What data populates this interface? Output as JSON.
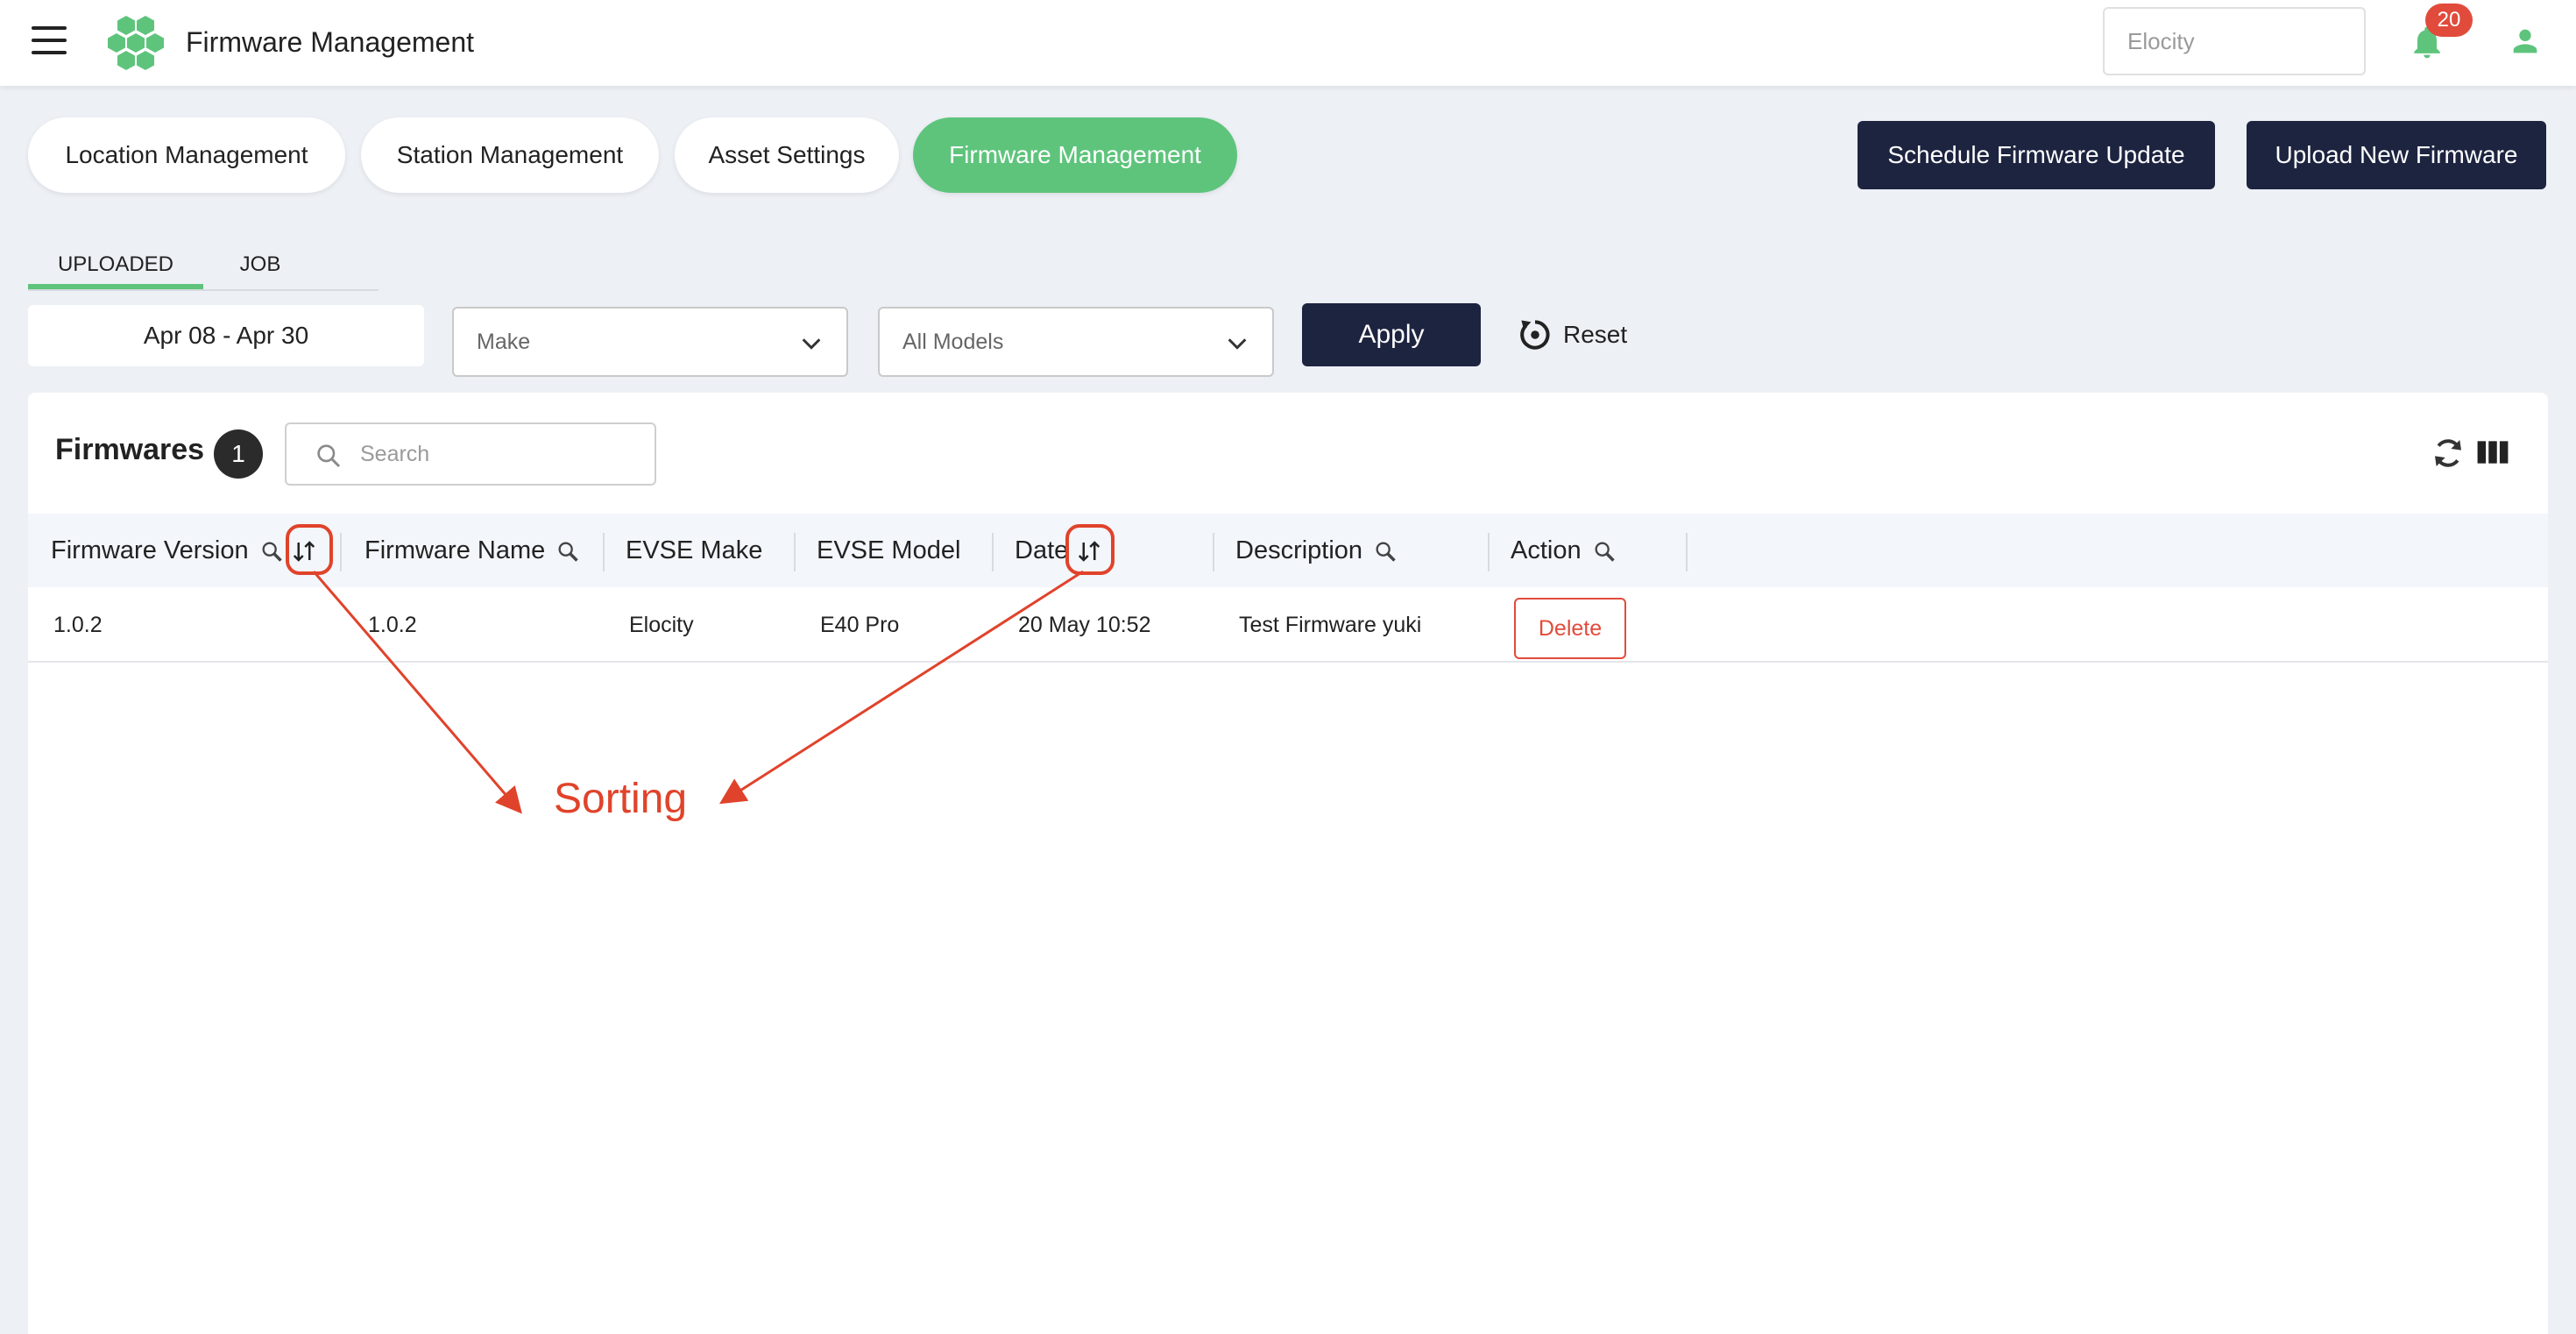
{
  "app": {
    "title": "Firmware Management",
    "org_value": "Elocity",
    "notification_count": "20"
  },
  "nav": {
    "tabs": [
      {
        "label": "Location Management"
      },
      {
        "label": "Station Management"
      },
      {
        "label": "Asset Settings"
      },
      {
        "label": "Firmware Management"
      }
    ],
    "active_tab": "Firmware Management",
    "schedule_label": "Schedule Firmware Update",
    "upload_label": "Upload New Firmware"
  },
  "subtabs": {
    "uploaded": "UPLOADED",
    "job": "JOB"
  },
  "filters": {
    "date_range": "Apr 08 - Apr 30",
    "make_placeholder": "Make",
    "model_value": "All Models",
    "apply_label": "Apply",
    "reset_label": "Reset"
  },
  "table": {
    "title": "Firmwares",
    "count": "1",
    "search_placeholder": "Search",
    "columns": {
      "version": "Firmware Version",
      "name": "Firmware Name",
      "make": "EVSE Make",
      "model": "EVSE Model",
      "date": "Date",
      "description": "Description",
      "action": "Action"
    },
    "rows": [
      {
        "version": "1.0.2",
        "name": "1.0.2",
        "make": "Elocity",
        "model": "E40 Pro",
        "date": "20 May 10:52",
        "description": "Test Firmware yuki",
        "action": "Delete"
      }
    ]
  },
  "annotation": {
    "label": "Sorting"
  },
  "colors": {
    "accent": "#5ec47c",
    "dark": "#1d2440",
    "danger": "#e14b3b",
    "annotation": "#e0432b"
  }
}
